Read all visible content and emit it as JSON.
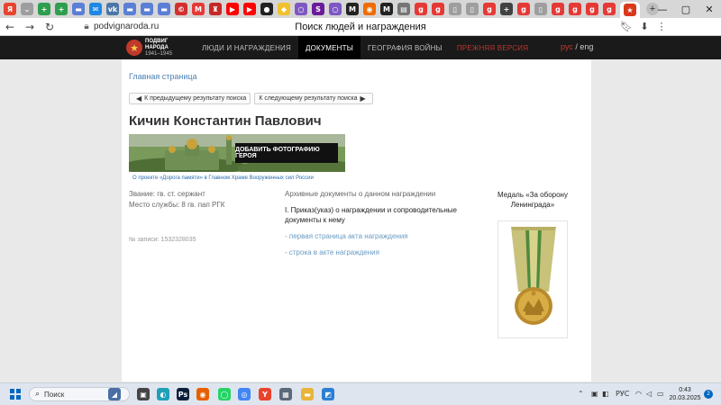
{
  "browser": {
    "tabs": [
      {
        "icon": "yandex-icon",
        "color": "#e8432e",
        "glyph": "Я"
      },
      {
        "icon": "menu-icon",
        "color": "#9e9e9e",
        "glyph": "⌄"
      },
      {
        "icon": "plus-green-icon",
        "color": "#2e9e4f",
        "glyph": "+"
      },
      {
        "icon": "plus-green-icon",
        "color": "#2e9e4f",
        "glyph": "+"
      },
      {
        "icon": "flag-icon",
        "color": "#5b7fd6",
        "glyph": "▬"
      },
      {
        "icon": "mail-icon",
        "color": "#1e88e5",
        "glyph": "✉"
      },
      {
        "icon": "vk-icon",
        "color": "#4a76a8",
        "glyph": "vk"
      },
      {
        "icon": "flag-icon",
        "color": "#5b7fd6",
        "glyph": "▬"
      },
      {
        "icon": "flag-icon",
        "color": "#5b7fd6",
        "glyph": "▬"
      },
      {
        "icon": "flag-icon",
        "color": "#5b7fd6",
        "glyph": "▬"
      },
      {
        "icon": "circle-red-icon",
        "color": "#d32f2f",
        "glyph": "©"
      },
      {
        "icon": "m-icon",
        "color": "#e53935",
        "glyph": "M"
      },
      {
        "icon": "castle-icon",
        "color": "#c62828",
        "glyph": "♜"
      },
      {
        "icon": "youtube-icon",
        "color": "#ff0000",
        "glyph": "▶"
      },
      {
        "icon": "youtube-icon",
        "color": "#ff0000",
        "glyph": "▶"
      },
      {
        "icon": "dot-icon",
        "color": "#222222",
        "glyph": "●"
      },
      {
        "icon": "duck-icon",
        "color": "#f2c12e",
        "glyph": "◆"
      },
      {
        "icon": "ring-icon",
        "color": "#7e57c2",
        "glyph": "○"
      },
      {
        "icon": "s-icon",
        "color": "#6a1b9a",
        "glyph": "S"
      },
      {
        "icon": "ring-icon",
        "color": "#7e57c2",
        "glyph": "○"
      },
      {
        "icon": "m-black-icon",
        "color": "#222222",
        "glyph": "M"
      },
      {
        "icon": "orange-icon",
        "color": "#ef6c00",
        "glyph": "◉"
      },
      {
        "icon": "m-black-icon",
        "color": "#222222",
        "glyph": "M"
      },
      {
        "icon": "doc-icon",
        "color": "#757575",
        "glyph": "▤"
      },
      {
        "icon": "red-circle-icon",
        "color": "#e53935",
        "glyph": "g"
      },
      {
        "icon": "red-circle-icon",
        "color": "#e53935",
        "glyph": "g"
      },
      {
        "icon": "page-icon",
        "color": "#9e9e9e",
        "glyph": "▯"
      },
      {
        "icon": "page-icon",
        "color": "#9e9e9e",
        "glyph": "▯"
      },
      {
        "icon": "red-circle-icon",
        "color": "#e53935",
        "glyph": "g"
      },
      {
        "icon": "plus-dark-icon",
        "color": "#424242",
        "glyph": "+"
      },
      {
        "icon": "red-circle-icon",
        "color": "#e53935",
        "glyph": "g"
      },
      {
        "icon": "page-icon",
        "color": "#9e9e9e",
        "glyph": "▯"
      },
      {
        "icon": "red-circle-icon",
        "color": "#e53935",
        "glyph": "g"
      },
      {
        "icon": "red-circle-icon",
        "color": "#e53935",
        "glyph": "g"
      },
      {
        "icon": "red-circle-icon",
        "color": "#e53935",
        "glyph": "g"
      },
      {
        "icon": "red-circle-icon",
        "color": "#e53935",
        "glyph": "g"
      }
    ],
    "active_tab_color": "#d9391a",
    "url": "podvignaroda.ru",
    "page_title": "Поиск людей и награждения"
  },
  "site": {
    "logo_line1": "ПОДВИГ",
    "logo_line2": "НАРОДА",
    "logo_years": "1941–1945",
    "nav": [
      {
        "label": "ЛЮДИ И НАГРАЖДЕНИЯ",
        "state": "normal"
      },
      {
        "label": "ДОКУМЕНТЫ",
        "state": "active"
      },
      {
        "label": "ГЕОГРАФИЯ ВОЙНЫ",
        "state": "normal"
      },
      {
        "label": "ПРЕЖНЯЯ ВЕРСИЯ",
        "state": "prev"
      }
    ],
    "lang_current": "рус",
    "lang_sep": " / ",
    "lang_other": "eng"
  },
  "content": {
    "breadcrumb": "Главная страница",
    "prev_result": "К предыдущему результату поиска",
    "next_result": "К следующему результату поиска",
    "hero_name": "Кичин Константин Павлович",
    "add_photo": "ДОБАВИТЬ ФОТОГРАФИЮ ГЕРОЯ",
    "project_link": "О проекте «Дорога памяти» в Главном Храме Вооруженных сил России",
    "rank": "Звание: гв. ст. сержант",
    "service": "Место службы: 8 гв. пап РГК",
    "record_no": "№ записи: 1532328035",
    "archive_header": "Архивные документы о данном награждении",
    "order_title": "I. Приказ(указ) о награждении и сопроводительные документы к нему",
    "link_first_page": "- первая страница акта награждения",
    "link_row": "- строка в акте награждения",
    "medal_title": "Медаль «За оборону Ленинграда»"
  },
  "taskbar": {
    "search_placeholder": "Поиск",
    "lang": "РУС",
    "time": "0:43",
    "date": "20.03.2025",
    "notifications": "2"
  }
}
